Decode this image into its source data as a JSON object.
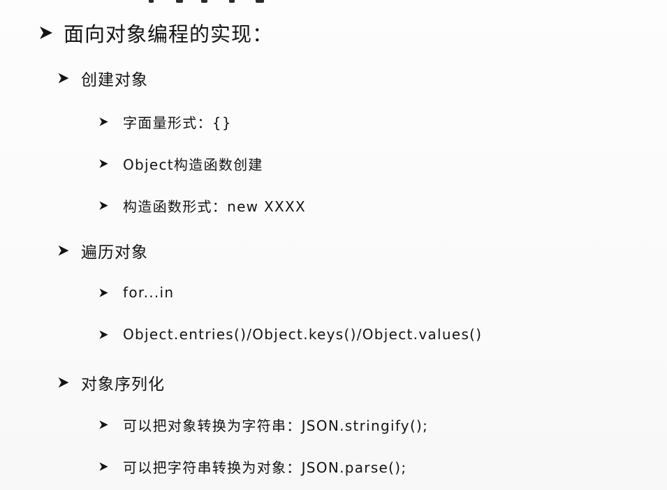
{
  "slide": {
    "heading": "面向对象编程的实现：",
    "sections": [
      {
        "title": "创建对象",
        "items": [
          "字面量形式：{}",
          "Object构造函数创建",
          "构造函数形式：new XXXX"
        ]
      },
      {
        "title": "遍历对象",
        "items": [
          "for...in",
          "Object.entries()/Object.keys()/Object.values()"
        ]
      },
      {
        "title": "对象序列化",
        "items": [
          "可以把对象转换为字符串：JSON.stringify();",
          "可以把字符串转换为对象：JSON.parse();"
        ]
      }
    ]
  },
  "bullet_icon": "arrow-bullet-icon",
  "colors": {
    "background": "#fbfbfb",
    "text": "#141414"
  }
}
